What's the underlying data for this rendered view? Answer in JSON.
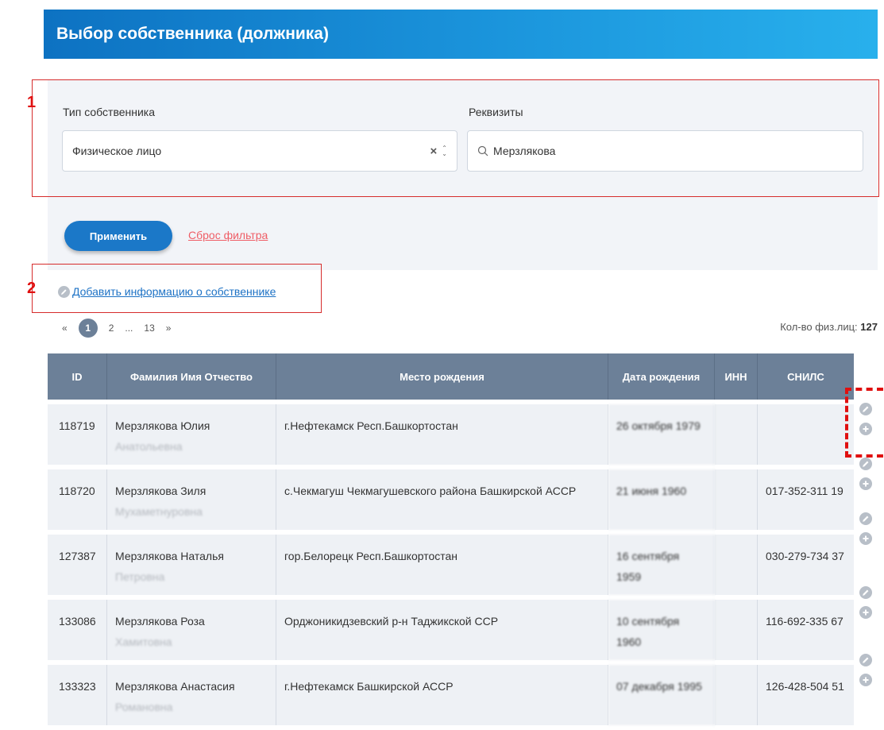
{
  "header": {
    "title": "Выбор собственника (должника)"
  },
  "annotations": {
    "box1": "1",
    "box2": "2"
  },
  "filter": {
    "owner_type_label": "Тип собственника",
    "owner_type_value": "Физическое лицо",
    "requisites_label": "Реквизиты",
    "requisites_value": "Мерзлякова",
    "apply_label": "Применить",
    "reset_label": "Сброс фильтра"
  },
  "add_owner": {
    "label": "Добавить информацию о собственнике"
  },
  "pagination": {
    "first": "«",
    "current": "1",
    "page2": "2",
    "ellipsis": "...",
    "last_page": "13",
    "next": "»"
  },
  "count": {
    "label": "Кол-во физ.лиц:",
    "value": "127"
  },
  "table": {
    "headers": [
      "ID",
      "Фамилия Имя Отчество",
      "Место рождения",
      "Дата рождения",
      "ИНН",
      "СНИЛС"
    ],
    "rows": [
      {
        "id": "118719",
        "name": "Мерзлякова Юлия",
        "patronymic": "Анатольевна",
        "birthplace": "г.Нефтекамск Респ.Башкортостан",
        "birthdate": "26 октября 1979",
        "inn": "",
        "snils": ""
      },
      {
        "id": "118720",
        "name": "Мерзлякова Зиля",
        "patronymic": "Мухаметнуровна",
        "birthplace": "с.Чекмагуш Чекмагушевского района Башкирской АССР",
        "birthdate": "21 июня 1960",
        "inn": "",
        "snils": "017-352-311 19"
      },
      {
        "id": "127387",
        "name": "Мерзлякова Наталья",
        "patronymic": "Петровна",
        "birthplace": "гор.Белорецк Респ.Башкортостан",
        "birthdate": "16 сентября 1959",
        "inn": "",
        "snils": "030-279-734 37"
      },
      {
        "id": "133086",
        "name": "Мерзлякова Роза",
        "patronymic": "Хамитовна",
        "birthplace": "Орджоникидзевский р-н Таджикской ССР",
        "birthdate": "10 сентября 1960",
        "inn": "",
        "snils": "116-692-335 67"
      },
      {
        "id": "133323",
        "name": "Мерзлякова Анастасия",
        "patronymic": "Романовна",
        "birthplace": "г.Нефтекамск Башкирской АССР",
        "birthdate": "07 декабря 1995",
        "inn": "",
        "snils": "126-428-504 51"
      }
    ]
  },
  "colors": {
    "header": "#1b8fd6",
    "table_header": "#6c8098",
    "accent_button": "#1b78c8",
    "reset_link": "#ef5d66",
    "annotation": "#e01010"
  }
}
